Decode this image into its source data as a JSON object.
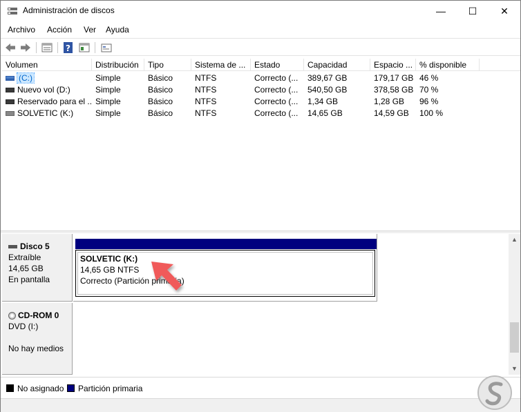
{
  "window": {
    "title": "Administración de discos",
    "min_glyph": "—",
    "max_glyph": "☐",
    "close_glyph": "✕"
  },
  "menu": {
    "items": [
      "Archivo",
      "Acción",
      "Ver",
      "Ayuda"
    ]
  },
  "toolbar": {
    "icons": [
      "back-icon",
      "forward-icon",
      "properties-icon",
      "help-icon",
      "console-tree-icon",
      "settings-icon"
    ]
  },
  "volume_list": {
    "headers": [
      "Volumen",
      "Distribución",
      "Tipo",
      "Sistema de ...",
      "Estado",
      "Capacidad",
      "Espacio ...",
      "% disponible"
    ],
    "rows": [
      {
        "volume": "(C:)",
        "layout": "Simple",
        "type": "Básico",
        "fs": "NTFS",
        "status": "Correcto (...",
        "capacity": "389,67 GB",
        "free": "179,17 GB",
        "pct": "46 %"
      },
      {
        "volume": "Nuevo vol (D:)",
        "layout": "Simple",
        "type": "Básico",
        "fs": "NTFS",
        "status": "Correcto (...",
        "capacity": "540,50 GB",
        "free": "378,58 GB",
        "pct": "70 %"
      },
      {
        "volume": "Reservado para el ...",
        "layout": "Simple",
        "type": "Básico",
        "fs": "NTFS",
        "status": "Correcto (...",
        "capacity": "1,34 GB",
        "free": "1,28 GB",
        "pct": "96 %"
      },
      {
        "volume": "SOLVETIC (K:)",
        "layout": "Simple",
        "type": "Básico",
        "fs": "NTFS",
        "status": "Correcto (...",
        "capacity": "14,65 GB",
        "free": "14,59 GB",
        "pct": "100 %"
      }
    ]
  },
  "disks": [
    {
      "name": "Disco 5",
      "line1": "Extraíble",
      "line2": "14,65 GB",
      "line3": "En pantalla",
      "partition": {
        "name": "SOLVETIC  (K:)",
        "size": "14,65 GB NTFS",
        "status": "Correcto (Partición primaria)"
      }
    },
    {
      "name": "CD-ROM 0",
      "line1": "DVD (I:)",
      "line2": "",
      "line3": "No hay medios"
    }
  ],
  "legend": {
    "unallocated": "No asignado",
    "primary": "Partición primaria"
  },
  "colors": {
    "primary_partition": "#00007f",
    "unallocated": "#000000",
    "arrow": "#f05a5a"
  }
}
